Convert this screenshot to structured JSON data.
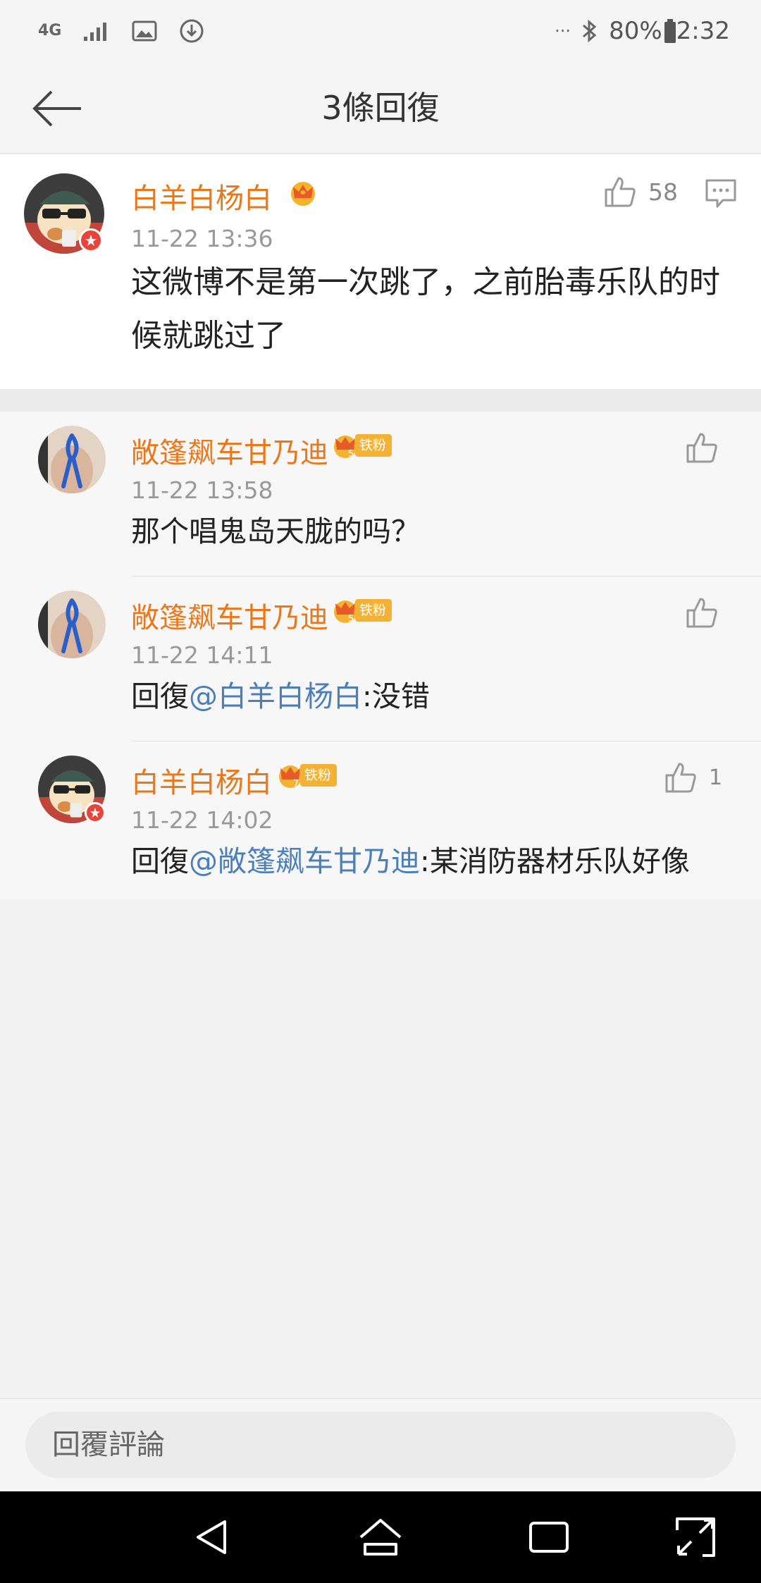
{
  "status_bar": {
    "network": "4G",
    "ellipsis": "···",
    "battery": "80%",
    "time": "2:32"
  },
  "header": {
    "title": "3條回復"
  },
  "main_comment": {
    "username": "白羊白杨白",
    "time": "11-22 13:36",
    "text": "这微博不是第一次跳了，之前胎毒乐队的时候就跳过了",
    "likes": "58"
  },
  "replies": [
    {
      "username": "敞篷飙车甘乃迪",
      "badge": "铁粉",
      "badge_level": "5",
      "time": "11-22 13:58",
      "prefix": "",
      "mention": "",
      "text": "那个唱鬼岛天胧的吗？",
      "likes": ""
    },
    {
      "username": "敞篷飙车甘乃迪",
      "badge": "铁粉",
      "badge_level": "5",
      "time": "11-22 14:11",
      "prefix": "回復",
      "mention": "@白羊白杨白",
      "text": ":没错",
      "likes": ""
    },
    {
      "username": "白羊白杨白",
      "badge": "铁粉",
      "badge_level": "7",
      "time": "11-22 14:02",
      "prefix": "回復",
      "mention": "@敞篷飙车甘乃迪",
      "text": ":某消防器材乐队好像",
      "likes": "1"
    }
  ],
  "reply_bar": {
    "placeholder": "回覆評論"
  },
  "colors": {
    "username": "#e8781b",
    "mention": "#4a7fba",
    "fan_badge": "#f3b233",
    "verified_badge": "#e8443a"
  }
}
